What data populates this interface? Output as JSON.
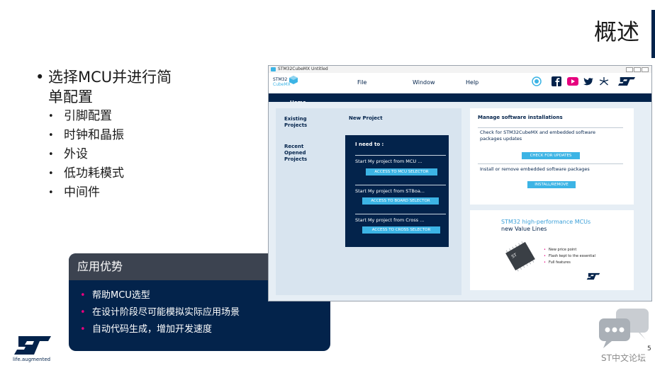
{
  "slide": {
    "title": "概述",
    "bullets": [
      {
        "text": "选择MCU并进行简单配置",
        "line1": "选择MCU并进行简",
        "line2": "单配置",
        "sub": [
          "引脚配置",
          "时钟和晶振",
          "外设",
          "低功耗模式",
          "中间件"
        ]
      }
    ],
    "advantages": {
      "heading": "应用优势",
      "items": [
        "帮助MCU选型",
        "在设计阶段尽可能模拟实际应用场景",
        "自动代码生成，增加开发速度"
      ]
    },
    "logo_text": "life.augmented",
    "forum_label": "ST中文论坛",
    "page_number": "5"
  },
  "app": {
    "window_title": "STM32CubeMX Untitled",
    "logo": {
      "line1": "STM32",
      "line2": "CubeMX"
    },
    "menu": [
      "File",
      "Window",
      "Help"
    ],
    "social_icons": [
      "anniversary-badge-icon",
      "facebook-icon",
      "youtube-icon",
      "twitter-icon",
      "network-icon",
      "st-logo-icon"
    ],
    "tab": "Home",
    "left": {
      "existing": "Existing Projects",
      "recent": "Recent Opened Projects",
      "new_project": "New Project",
      "need_title": "I need to :",
      "options": [
        {
          "text": "Start My project from MCU   ...",
          "button": "ACCESS TO MCU SELECTOR"
        },
        {
          "text": "Start My project from STBoa...",
          "button": "ACCESS TO BOARD SELECTOR"
        },
        {
          "text": "Start My project from Cross ...",
          "button": "ACCESS TO CROSS SELECTOR"
        }
      ]
    },
    "manage": {
      "title": "Manage software installations",
      "check_text": "Check for STM32CubeMX and embedded software packages updates",
      "check_button": "CHECK FOR UPDATES",
      "install_text": "Install or remove embedded software packages",
      "install_button": "INSTALL/REMOVE"
    },
    "ad": {
      "title1": "STM32 high-performance MCUs",
      "title2": "new Value Lines",
      "features": [
        "New price point",
        "Flash kept to the essential",
        "Full features"
      ]
    }
  },
  "colors": {
    "navy": "#03234b",
    "accent_blue": "#3cb4e5",
    "magenta": "#e6007e"
  }
}
